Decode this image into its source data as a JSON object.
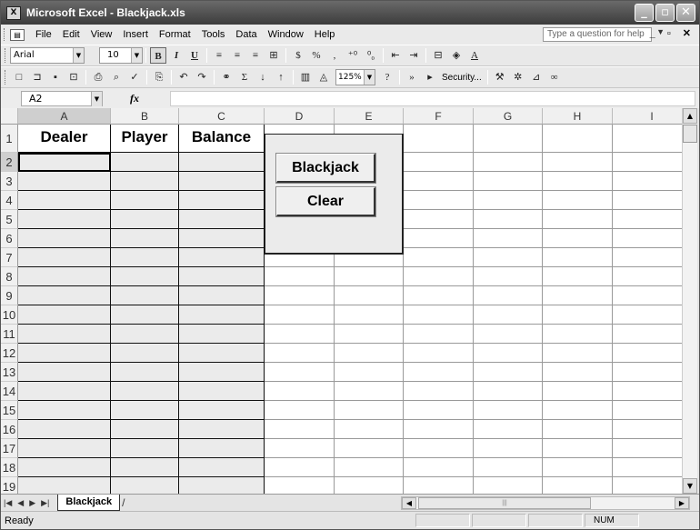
{
  "window": {
    "title": "Microsoft Excel - Blackjack.xls",
    "app_icon": "excel-icon",
    "controls": [
      "minimize",
      "restore",
      "close"
    ]
  },
  "menubar": {
    "items": [
      "File",
      "Edit",
      "View",
      "Insert",
      "Format",
      "Tools",
      "Data",
      "Window",
      "Help"
    ],
    "help_placeholder": "Type a question for help"
  },
  "toolbar": {
    "font_name": "Arial",
    "font_size": "10",
    "bold": "B",
    "italic": "I",
    "underline": "U",
    "currency": "$",
    "percent": "%",
    "comma": ",",
    "sum": "Σ",
    "zoom": "125%",
    "security_label": "Security..."
  },
  "formula_bar": {
    "name_box": "A2",
    "fx_label": "fx",
    "formula": ""
  },
  "grid": {
    "columns": [
      "A",
      "B",
      "C",
      "D",
      "E",
      "F",
      "G",
      "H",
      "I"
    ],
    "rows": [
      "1",
      "2",
      "3",
      "4",
      "5",
      "6",
      "7",
      "8",
      "9",
      "10",
      "11",
      "12",
      "13",
      "14",
      "15",
      "16",
      "17",
      "18",
      "19"
    ],
    "headers": {
      "A1": "Dealer",
      "B1": "Player",
      "C1": "Balance"
    },
    "active_cell": "A2"
  },
  "controls": {
    "blackjack_label": "Blackjack",
    "clear_label": "Clear"
  },
  "sheets": {
    "tabs": [
      "Blackjack"
    ]
  },
  "statusbar": {
    "status": "Ready",
    "num_indicator": "NUM"
  }
}
